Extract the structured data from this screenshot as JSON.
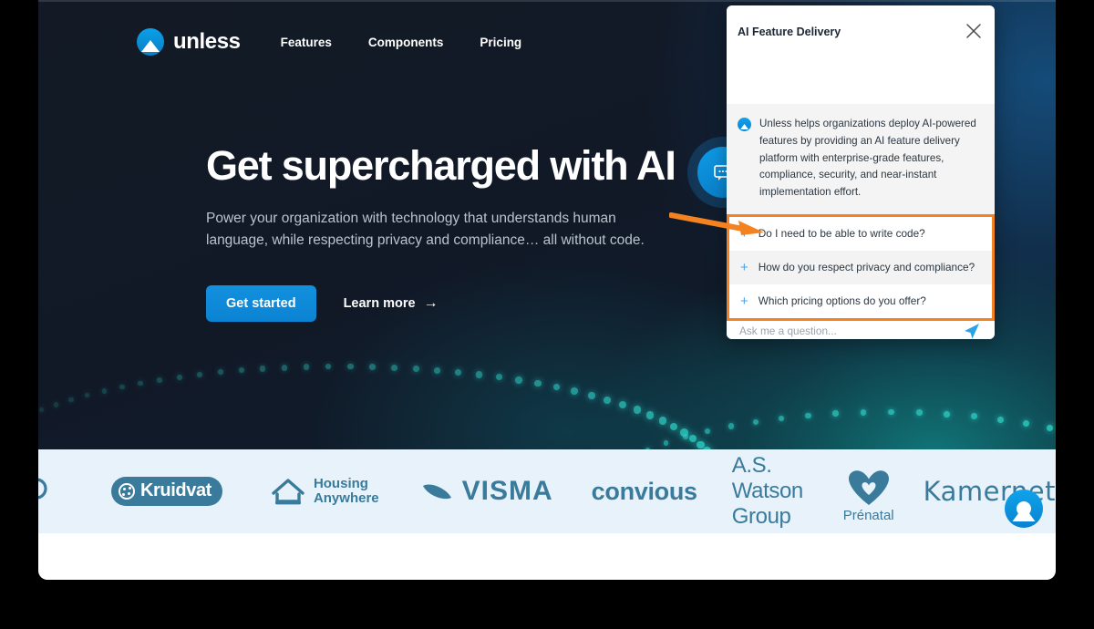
{
  "nav": {
    "brand_name": "unless",
    "logo_icon": "unless-arch-logo-icon",
    "links": [
      {
        "label": "Features"
      },
      {
        "label": "Components"
      },
      {
        "label": "Pricing"
      }
    ]
  },
  "hero": {
    "headline": "Get supercharged with AI",
    "subhead": "Power your organization with technology that understands human language, while respecting privacy and compliance… all without code.",
    "primary_cta": "Get started",
    "secondary_cta": "Learn more",
    "secondary_cta_arrow": "→",
    "bubble_icon": "chat-bubble-icon",
    "annotation_arrow_color": "#f58220",
    "background_colors": {
      "base": "#111927",
      "blue_glow": "#155487",
      "teal_glow": "#10787a",
      "dot_color": "#2fd0c5"
    }
  },
  "logobar": {
    "background": "#e8f2fb",
    "logo_color": "#3a7a9b",
    "logos": [
      {
        "name": "Kruidvat"
      },
      {
        "name": "Housing Anywhere",
        "line1": "Housing",
        "line2": "Anywhere"
      },
      {
        "name": "VISMA"
      },
      {
        "name": "convious"
      },
      {
        "name": "A.S. Watson Group"
      },
      {
        "name": "Prénatal"
      },
      {
        "name": "Kamernet"
      }
    ]
  },
  "launcher": {
    "icon": "unless-arch-logo-icon",
    "color": "#0a8ad8"
  },
  "widget": {
    "title": "AI Feature Delivery",
    "close_icon": "close-icon",
    "bot_avatar_icon": "unless-arch-logo-icon",
    "message": "Unless helps organizations deploy AI-powered features by providing an AI feature delivery platform with enterprise-grade features, compliance, security, and near-instant implementation effort.",
    "highlight_color": "#f58220",
    "questions": [
      {
        "label": "Do I need to be able to write code?",
        "plus": "+"
      },
      {
        "label": "How do you respect privacy and compliance?",
        "plus": "+"
      },
      {
        "label": "Which pricing options do you offer?",
        "plus": "+"
      }
    ],
    "input_placeholder": "Ask me a question...",
    "input_value": "",
    "send_icon": "send-paper-plane-icon"
  }
}
